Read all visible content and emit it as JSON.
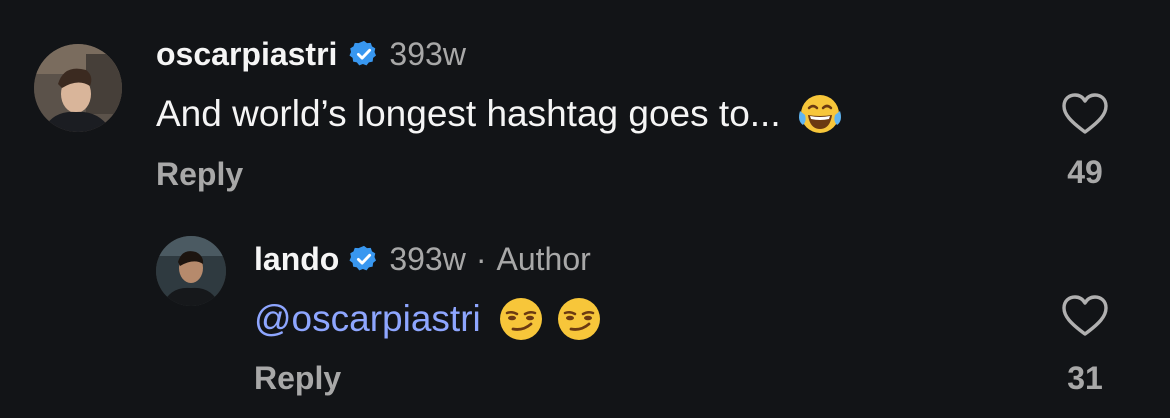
{
  "comments": [
    {
      "username": "oscarpiastri",
      "time": "393w",
      "text": "And world’s longest hashtag goes to...",
      "emoji": "face-with-tears-of-joy",
      "reply_label": "Reply",
      "likes": "49"
    }
  ],
  "reply": {
    "username": "lando",
    "time": "393w",
    "separator": "·",
    "author_label": "Author",
    "mention": "@oscarpiastri",
    "emoji": "smirking-face",
    "reply_label": "Reply",
    "likes": "31"
  },
  "colors": {
    "background": "#121417",
    "verified": "#3897f0",
    "mention": "#8ea6ff",
    "secondary_text": "#a8a8a8"
  },
  "icons": [
    "verified-badge-icon",
    "heart-outline-icon"
  ]
}
